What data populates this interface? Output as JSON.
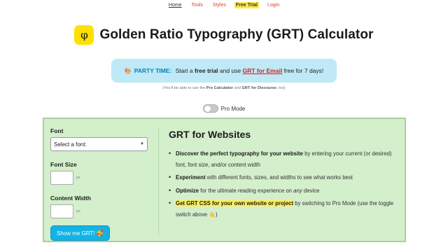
{
  "nav": {
    "items": [
      {
        "label": "Home"
      },
      {
        "label": "Tools"
      },
      {
        "label": "Styles"
      },
      {
        "label": "Free Trial"
      },
      {
        "label": "Login"
      }
    ]
  },
  "header": {
    "logo_glyph": "φ",
    "title": "Golden Ratio Typography (GRT) Calculator"
  },
  "promo": {
    "icon": "🎨",
    "prefix": "PARTY TIME:",
    "text1": " Start a ",
    "bold1": "free trial",
    "text2": " and use ",
    "link": "GRT for Email",
    "text3": " free for 7 days!"
  },
  "note": {
    "text1": "(You'll be able to use the ",
    "bold1": "Pro Calculator",
    "text2": " and ",
    "bold2": "GRT for Discourse",
    "text3": ", too)"
  },
  "pro_mode": {
    "label": "Pro Mode",
    "enabled": false
  },
  "form": {
    "font_label": "Font",
    "font_select_value": "Select a font:",
    "font_size_label": "Font Size",
    "font_size_value": "",
    "font_size_unit": "px",
    "content_width_label": "Content Width",
    "content_width_value": "",
    "content_width_unit": "px",
    "submit_label": "Show me GRT! 🥰"
  },
  "info": {
    "heading": "GRT for Websites",
    "bullets": [
      {
        "bold": "Discover the perfect typography for your website",
        "text": " by entering your current (or desired) font, font size, and/or content width"
      },
      {
        "bold": "Experiment",
        "text": " with different fonts, sizes, and widths to see what works best"
      },
      {
        "bold": "Optimize",
        "text": " for the ultimate reading experience on ",
        "em": "any",
        "text2": " device"
      },
      {
        "bold": "Get GRT CSS for your own website or project",
        "text": " by switching to Pro Mode (use the toggle switch above 👆)"
      }
    ]
  },
  "colors": {
    "accent": "#d2462b",
    "logo_bg": "#ffe000",
    "promo_bg": "#bfe9f7",
    "panel_bg": "#d3efcb",
    "button_bg": "#13b3e6",
    "highlight": "#ffee58"
  }
}
